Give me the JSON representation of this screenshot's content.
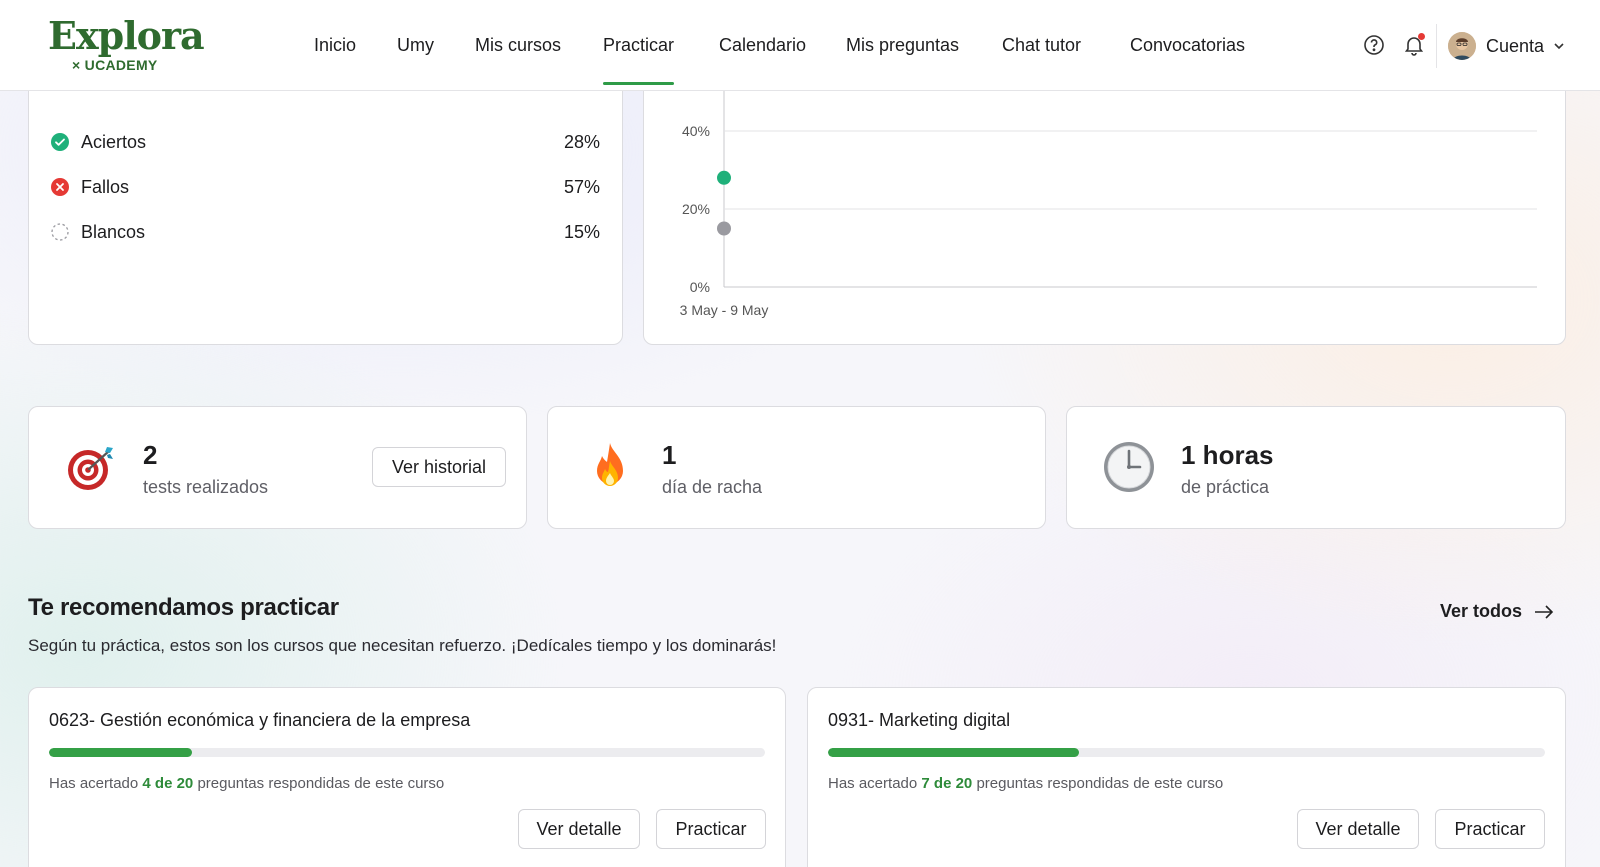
{
  "header": {
    "logo_main": "Explora",
    "logo_sub": "× UCADEMY",
    "nav": [
      {
        "label": "Inicio"
      },
      {
        "label": "Umy"
      },
      {
        "label": "Mis cursos"
      },
      {
        "label": "Practicar"
      },
      {
        "label": "Calendario"
      },
      {
        "label": "Mis preguntas"
      },
      {
        "label": "Chat tutor"
      },
      {
        "label": "Convocatorias"
      }
    ],
    "active_nav": "Practicar",
    "account_label": "Cuenta",
    "icons": [
      "help-circle-icon",
      "bell-icon",
      "chevron-down-icon"
    ],
    "notification_dot_color": "#e53935"
  },
  "results": {
    "items": [
      {
        "label": "Aciertos",
        "value": "28%",
        "icon": "check-circle-icon",
        "color": "#1fb07a"
      },
      {
        "label": "Fallos",
        "value": "57%",
        "icon": "x-circle-icon",
        "color": "#e53935"
      },
      {
        "label": "Blancos",
        "value": "15%",
        "icon": "dashed-circle-icon",
        "color": "#9a9aa0"
      }
    ]
  },
  "chart_data": {
    "type": "scatter",
    "x": [
      "3 May - 9 May"
    ],
    "series": [
      {
        "values": [
          28
        ],
        "color": "#1fb07a"
      },
      {
        "values": [
          15
        ],
        "color": "#9a9aa0"
      }
    ],
    "yticks": [
      "0%",
      "20%",
      "40%"
    ],
    "ylim": [
      0,
      40
    ],
    "grid": true
  },
  "metrics": [
    {
      "value": "2",
      "label": "tests realizados",
      "icon": "target-dart-icon",
      "button": "Ver historial"
    },
    {
      "value": "1",
      "label": "día de racha",
      "icon": "fire-icon"
    },
    {
      "value": "1 horas",
      "label": "de práctica",
      "icon": "clock-icon"
    }
  ],
  "recommend": {
    "title": "Te recomendamos practicar",
    "subtitle": "Según tu práctica, estos son los cursos que necesitan refuerzo. ¡Dedícales tiempo y los dominarás!",
    "see_all": "Ver todos",
    "courses": [
      {
        "title": "0623- Gestión económica y financiera de la empresa",
        "correct": 4,
        "total": 20,
        "meta_prefix": "Has acertado",
        "meta_count": "4 de 20",
        "meta_suffix": "preguntas respondidas de este curso",
        "btn_detail": "Ver detalle",
        "btn_practice": "Practicar"
      },
      {
        "title": "0931- Marketing digital",
        "correct": 7,
        "total": 20,
        "meta_prefix": "Has acertado",
        "meta_count": "7 de 20",
        "meta_suffix": "preguntas respondidas de este curso",
        "btn_detail": "Ver detalle",
        "btn_practice": "Practicar"
      }
    ]
  },
  "colors": {
    "accent_green": "#2e9b47",
    "logo_green": "#2f6b2f",
    "progress_green": "#34a046"
  }
}
